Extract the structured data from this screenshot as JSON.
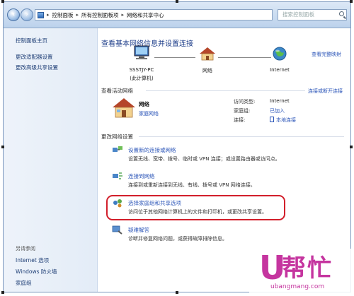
{
  "address": {
    "crumbs": [
      "控制面板",
      "所有控制面板项",
      "网络和共享中心"
    ],
    "search_placeholder": "搜索控制面板"
  },
  "sidebar": {
    "home": "控制面板主页",
    "items": [
      "更改适配器设置",
      "更改高级共享设置"
    ],
    "see_also_label": "另请参阅",
    "see_also": [
      "Internet 选项",
      "Windows 防火墙",
      "家庭组"
    ]
  },
  "main": {
    "title": "查看基本网络信息并设置连接",
    "full_map": "查看完整映射",
    "map": {
      "computer": "SSSTJY-PC",
      "computer_sub": "(此计算机)",
      "network": "网络",
      "internet": "Internet"
    },
    "active_section": "查看活动网络",
    "connect_link": "连接或断开连接",
    "active": {
      "name": "网络",
      "type": "家庭网络",
      "access_label": "访问类型:",
      "access_value": "Internet",
      "homegroup_label": "家庭组:",
      "homegroup_value": "已加入",
      "connection_label": "连接:",
      "connection_value": "本地连接"
    },
    "change_section": "更改网络设置",
    "tasks": [
      {
        "title": "设置新的连接或网络",
        "desc": "设置无线、宽带、拨号、临时或 VPN 连接；或设置路由器或访问点。"
      },
      {
        "title": "连接到网络",
        "desc": "连接到或重新连接到无线、有线、拨号或 VPN 网络连接。"
      },
      {
        "title": "选择家庭组和共享选项",
        "desc": "访问位于其他网络计算机上的文件和打印机，或更改共享设置。"
      },
      {
        "title": "疑难解答",
        "desc": "诊断并修复网络问题，或获得故障排除信息。"
      }
    ]
  },
  "watermark": {
    "logo_u": "U",
    "logo_cn": "帮忙",
    "url": "ubangmang.com"
  },
  "colors": {
    "link": "#2b55b8",
    "title": "#1e3e8a",
    "highlight": "#d21f2b",
    "watermark": "#c5359f"
  }
}
